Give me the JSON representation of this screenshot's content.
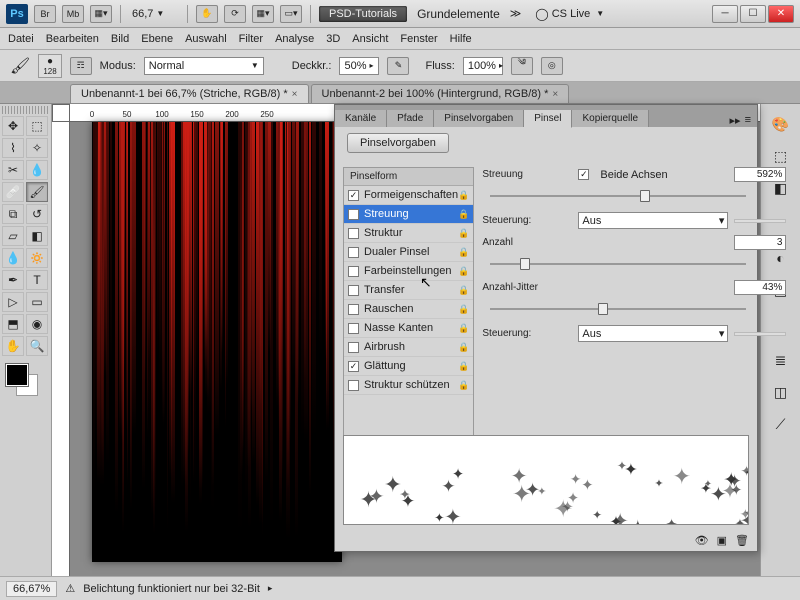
{
  "titlebar": {
    "zoom": "66,7",
    "psdtutorials": "PSD-Tutorials",
    "doc": "Grundelemente",
    "cslive": "CS Live"
  },
  "menu": [
    "Datei",
    "Bearbeiten",
    "Bild",
    "Ebene",
    "Auswahl",
    "Filter",
    "Analyse",
    "3D",
    "Ansicht",
    "Fenster",
    "Hilfe"
  ],
  "optbar": {
    "size": "128",
    "modus_lbl": "Modus:",
    "modus_val": "Normal",
    "deck_lbl": "Deckkr.:",
    "deck_val": "50%",
    "fluss_lbl": "Fluss:",
    "fluss_val": "100%"
  },
  "tabs": [
    {
      "label": "Unbenannt-1 bei 66,7% (Striche, RGB/8) *"
    },
    {
      "label": "Unbenannt-2 bei 100% (Hintergrund, RGB/8) *"
    }
  ],
  "ruler": [
    "0",
    "50",
    "100",
    "150",
    "200",
    "250"
  ],
  "panel": {
    "tabs": [
      "Kanäle",
      "Pfade",
      "Pinselvorgaben",
      "Pinsel",
      "Kopierquelle"
    ],
    "preset_btn": "Pinselvorgaben",
    "form_hdr": "Pinselform",
    "items": [
      {
        "label": "Formeigenschaften",
        "checked": true
      },
      {
        "label": "Streuung",
        "checked": true,
        "selected": true
      },
      {
        "label": "Struktur",
        "checked": false
      },
      {
        "label": "Dualer Pinsel",
        "checked": false
      },
      {
        "label": "Farbeinstellungen",
        "checked": false
      },
      {
        "label": "Transfer",
        "checked": false
      },
      {
        "label": "Rauschen",
        "checked": false
      },
      {
        "label": "Nasse Kanten",
        "checked": false
      },
      {
        "label": "Airbrush",
        "checked": false
      },
      {
        "label": "Glättung",
        "checked": true
      },
      {
        "label": "Struktur schützen",
        "checked": false
      }
    ],
    "streuung_lbl": "Streuung",
    "beide": "Beide Achsen",
    "streuung_val": "592%",
    "steuerung_lbl": "Steuerung:",
    "steuerung_val": "Aus",
    "anzahl_lbl": "Anzahl",
    "anzahl_val": "3",
    "jitter_lbl": "Anzahl-Jitter",
    "jitter_val": "43%",
    "steuerung2_val": "Aus"
  },
  "status": {
    "zoom": "66,67%",
    "msg": "Belichtung funktioniert nur bei 32-Bit"
  }
}
